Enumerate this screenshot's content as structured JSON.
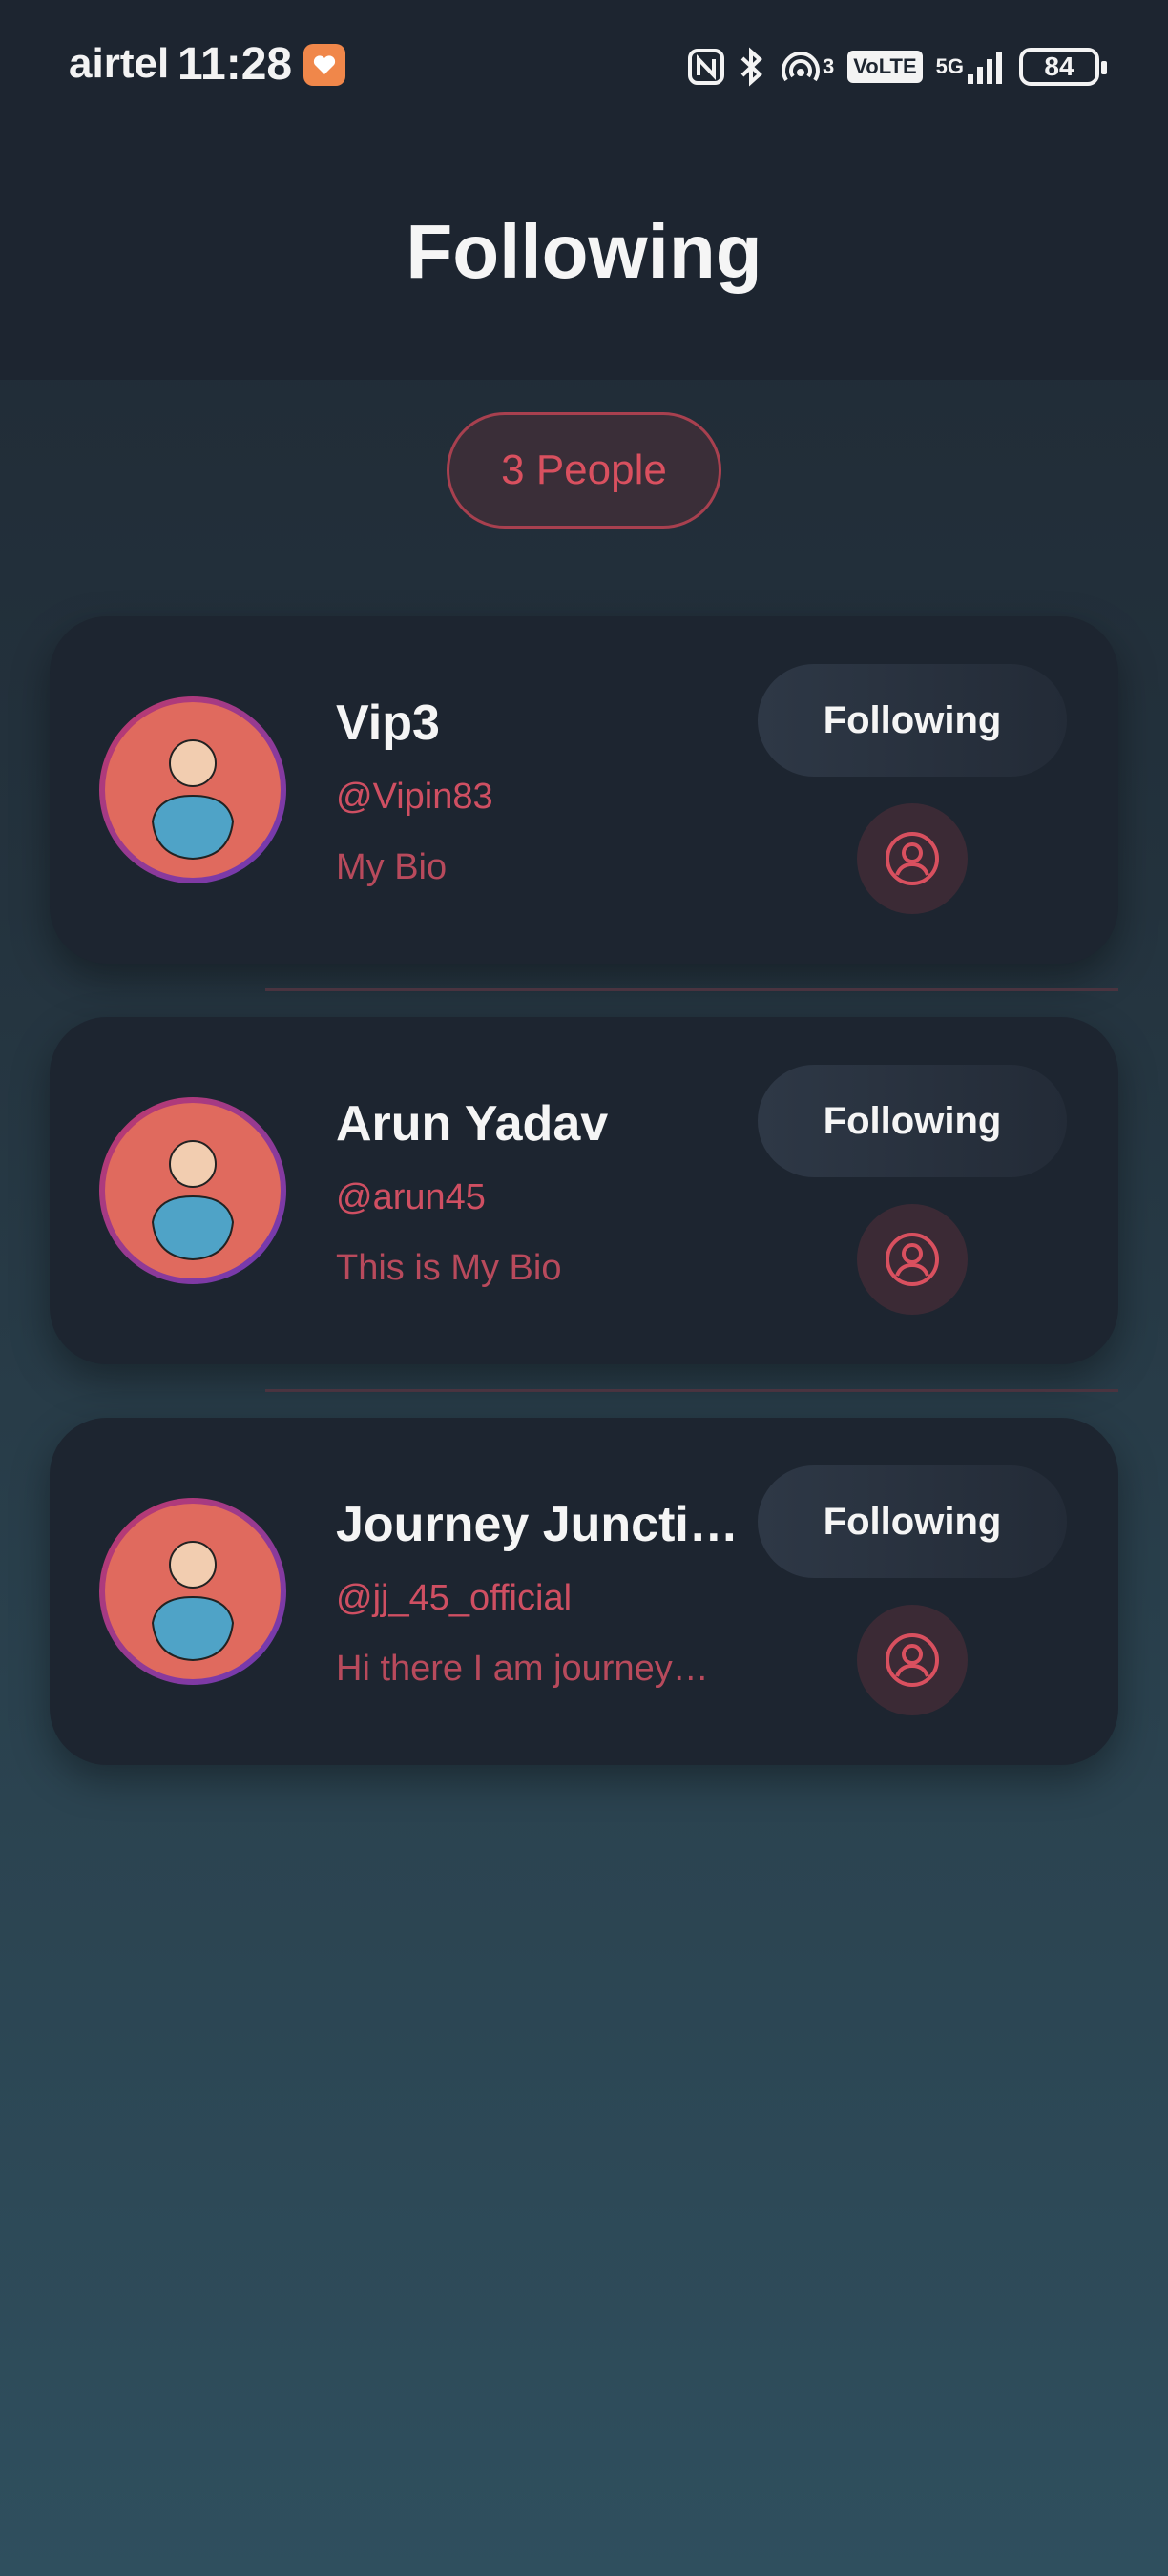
{
  "status_bar": {
    "carrier": "airtel",
    "time": "11:28",
    "signal_label": "5G",
    "volte": "VoLTE",
    "hotspot_count": "3",
    "battery": "84"
  },
  "header": {
    "title": "Following"
  },
  "count_label": "3 People",
  "users": [
    {
      "name": "Vip3",
      "handle": "@Vipin83",
      "bio": "My Bio",
      "button": "Following"
    },
    {
      "name": "Arun Yadav",
      "handle": "@arun45",
      "bio": "This is My Bio",
      "button": "Following"
    },
    {
      "name": "Journey Juncti…",
      "handle": "@jj_45_official",
      "bio": "Hi there I am journey…",
      "button": "Following"
    }
  ],
  "colors": {
    "accent": "#d9505f",
    "card": "#1d2530",
    "header": "#1d2530"
  },
  "icons": {
    "profile": "person-circle-icon",
    "avatar": "person-avatar-icon",
    "notification": "heart-badge-icon"
  }
}
